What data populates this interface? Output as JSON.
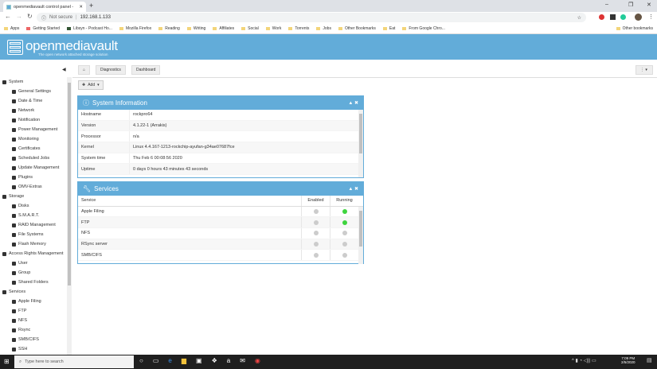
{
  "browser": {
    "tab_title": "openmediavault control panel - ",
    "address_security": "Not secure",
    "address": "192.168.1.133",
    "bookmarks": [
      "Apps",
      "Getting Started",
      "Libsyn - Podcast Ho...",
      "Mozilla Firefox",
      "Reading",
      "Writing",
      "Affiliates",
      "Social",
      "Work",
      "Torrents",
      "Jobs",
      "Other Bookmarks",
      "Eat",
      "From Google Chro..."
    ],
    "other_bookmarks": "Other bookmarks"
  },
  "header": {
    "brand": "openmediavault",
    "tagline": "The open network attached storage solution"
  },
  "breadcrumb": [
    "Diagnostics",
    "Dashboard"
  ],
  "toolbar": {
    "add_label": "Add"
  },
  "sidebar": [
    {
      "label": "System",
      "items": [
        "General Settings",
        "Date & Time",
        "Network",
        "Notification",
        "Power Management",
        "Monitoring",
        "Certificates",
        "Scheduled Jobs",
        "Update Management",
        "Plugins",
        "OMV-Extras"
      ]
    },
    {
      "label": "Storage",
      "items": [
        "Disks",
        "S.M.A.R.T.",
        "RAID Management",
        "File Systems",
        "Flash Memory"
      ]
    },
    {
      "label": "Access Rights Management",
      "items": [
        "User",
        "Group",
        "Shared Folders"
      ]
    },
    {
      "label": "Services",
      "items": [
        "Apple Filing",
        "FTP",
        "NFS",
        "Rsync",
        "SMB/CIFS",
        "SSH"
      ]
    }
  ],
  "system_info": {
    "title": "System Information",
    "rows": [
      {
        "key": "Hostname",
        "value": "rockpro64"
      },
      {
        "key": "Version",
        "value": "4.1.22-1 (Arrakis)"
      },
      {
        "key": "Processor",
        "value": "n/a"
      },
      {
        "key": "Kernel",
        "value": "Linux 4.4.167-1213-rockchip-ayufan-g34ae07687fce"
      },
      {
        "key": "System time",
        "value": "Thu Feb 6 00:08:56 2020"
      },
      {
        "key": "Uptime",
        "value": "0 days 0 hours 43 minutes 43 seconds"
      }
    ]
  },
  "services": {
    "title": "Services",
    "columns": [
      "Service",
      "Enabled",
      "Running"
    ],
    "rows": [
      {
        "name": "Apple Filing",
        "enabled": false,
        "running": true
      },
      {
        "name": "FTP",
        "enabled": false,
        "running": true
      },
      {
        "name": "NFS",
        "enabled": false,
        "running": false
      },
      {
        "name": "RSync server",
        "enabled": false,
        "running": false
      },
      {
        "name": "SMB/CIFS",
        "enabled": false,
        "running": false
      }
    ]
  },
  "taskbar": {
    "search_placeholder": "Type here to search",
    "time": "7:09 PM",
    "date": "2/5/2020"
  }
}
